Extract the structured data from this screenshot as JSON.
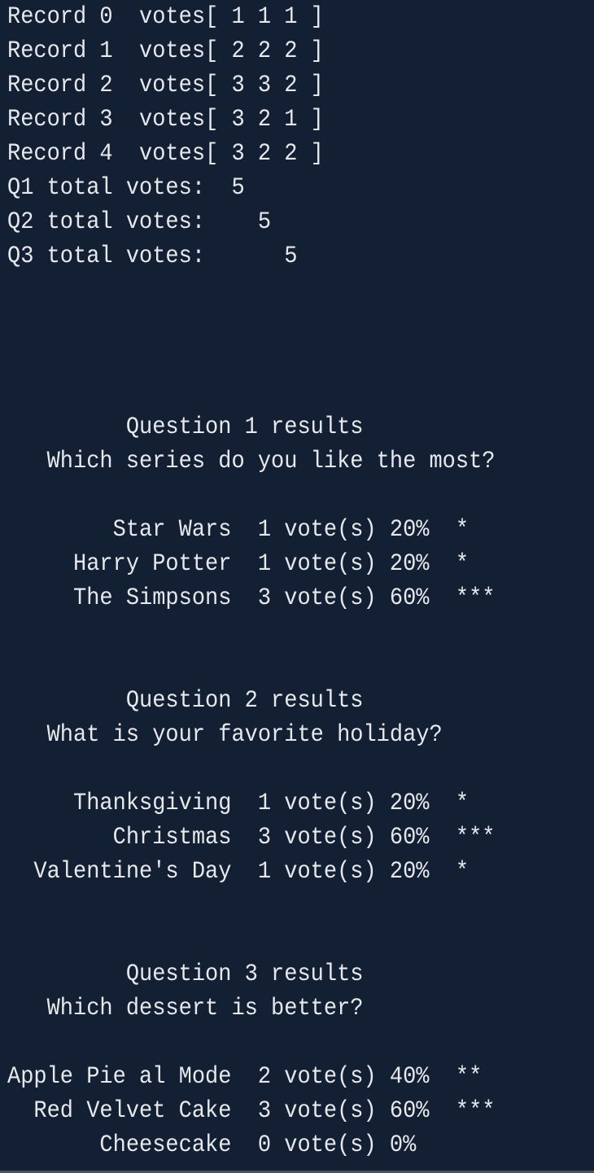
{
  "terminal": {
    "lines": [
      "Record 0  votes[ 1 1 1 ]",
      "Record 1  votes[ 2 2 2 ]",
      "Record 2  votes[ 3 3 2 ]",
      "Record 3  votes[ 3 2 1 ]",
      "Record 4  votes[ 3 2 2 ]",
      "Q1 total votes:  5",
      "Q2 total votes:    5",
      "Q3 total votes:      5",
      "",
      "",
      "",
      "",
      "         Question 1 results",
      "   Which series do you like the most?",
      "",
      "        Star Wars  1 vote(s) 20%  *",
      "     Harry Potter  1 vote(s) 20%  *",
      "     The Simpsons  3 vote(s) 60%  ***",
      "",
      "",
      "         Question 2 results",
      "   What is your favorite holiday?",
      "",
      "     Thanksgiving  1 vote(s) 20%  *",
      "        Christmas  3 vote(s) 60%  ***",
      "  Valentine's Day  1 vote(s) 20%  *",
      "",
      "",
      "         Question 3 results",
      "   Which dessert is better?",
      "",
      "Apple Pie al Mode  2 vote(s) 40%  **",
      "  Red Velvet Cake  3 vote(s) 60%  ***",
      "       Cheesecake  0 vote(s) 0%"
    ]
  }
}
